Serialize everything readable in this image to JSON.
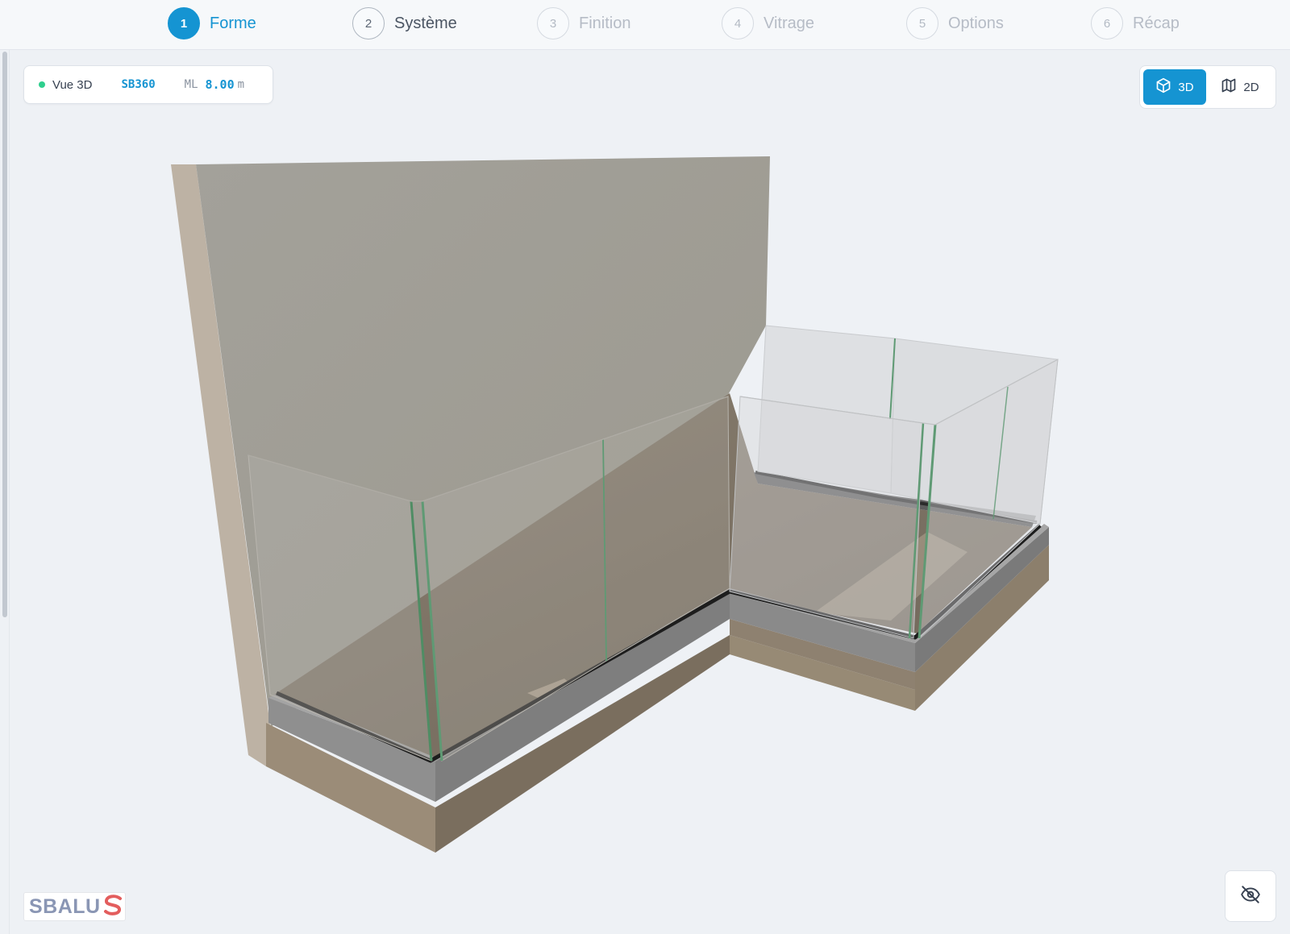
{
  "stepper": {
    "steps": [
      {
        "number": "1",
        "label": "Forme"
      },
      {
        "number": "2",
        "label": "Système"
      },
      {
        "number": "3",
        "label": "Finition"
      },
      {
        "number": "4",
        "label": "Vitrage"
      },
      {
        "number": "5",
        "label": "Options"
      },
      {
        "number": "6",
        "label": "Récap"
      }
    ],
    "active_step": 1
  },
  "info": {
    "view_label": "Vue 3D",
    "system_code": "SB360",
    "ml_label": "ML",
    "ml_value": "8.00",
    "ml_unit": "m"
  },
  "view_toggle": {
    "options": [
      "3D",
      "2D"
    ],
    "selected": "3D"
  },
  "logo": {
    "text": "SBALU"
  },
  "colors": {
    "accent": "#1594d2",
    "status_dot": "#2fcf8e",
    "wall": "#a19e97",
    "slab": "#9b8c78",
    "glass_edge": "#5f9a74"
  },
  "icons": {
    "view_3d": "cube-icon",
    "view_2d": "map-icon",
    "hide": "eye-off-icon"
  }
}
